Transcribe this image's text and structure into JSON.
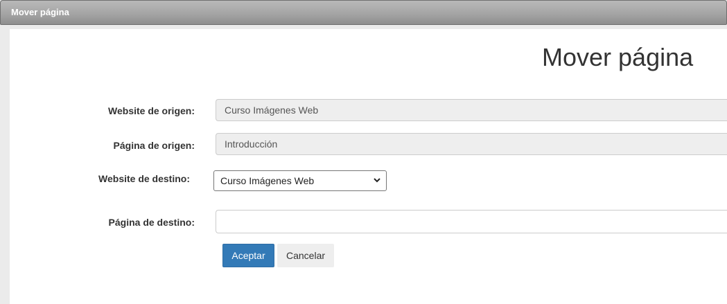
{
  "window": {
    "title": "Mover página"
  },
  "page": {
    "heading": "Mover página"
  },
  "form": {
    "source_website": {
      "label": "Website de origen:",
      "value": "Curso Imágenes Web"
    },
    "source_page": {
      "label": "Página de origen:",
      "value": "Introducción"
    },
    "target_website": {
      "label": "Website de destino:",
      "selected": "Curso Imágenes Web"
    },
    "target_page": {
      "label": "Página de destino:",
      "value": ""
    }
  },
  "buttons": {
    "accept": "Aceptar",
    "cancel": "Cancelar"
  },
  "colors": {
    "primary": "#337ab7",
    "titlebar": "#a5a5a5"
  }
}
